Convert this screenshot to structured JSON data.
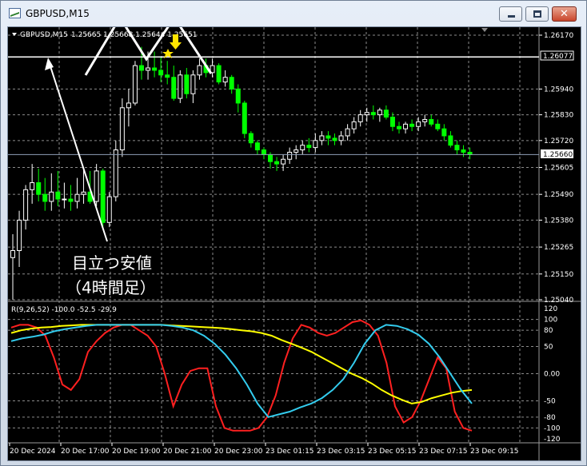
{
  "window": {
    "title": "GBPUSD,M15",
    "buttons": {
      "minimize": "minimize-icon",
      "maximize": "maximize-icon",
      "close": "close-icon"
    }
  },
  "colors": {
    "background": "#000000",
    "grid": "#8c8c8c",
    "bull_candle": "#ffffff",
    "bear_candle": "#00ff00",
    "text": "#ffffff",
    "stochastic_main": "#ff2020",
    "stochastic_slow": "#ffff00",
    "stochastic_third": "#33ccee",
    "annotation": "#ffffff",
    "arrow_marker": "#ffe400"
  },
  "price_header": {
    "symbol": "GBPUSD,M15",
    "values": "1.25665 1.25668 1.25644 1.25651"
  },
  "price_tags": {
    "high_line": "1.26077",
    "current": "1.25660"
  },
  "annotation": {
    "line1": "目立つ安値",
    "line2": "（4時間足）"
  },
  "indicator_header": "R(9,26,52) -100.0 -52.5 -29.9",
  "chart_data": [
    {
      "type": "candlestick",
      "title": "GBPUSD,M15",
      "y_ticks": [
        "1.26170",
        "1.25940",
        "1.25830",
        "1.25720",
        "1.25605",
        "1.25490",
        "1.25380",
        "1.25265",
        "1.25150",
        "1.25040"
      ],
      "ylim": [
        1.2504,
        1.2617
      ],
      "x_ticks": [
        "20 Dec 2024",
        "20 Dec 17:00",
        "20 Dec 19:00",
        "20 Dec 21:00",
        "20 Dec 23:00",
        "23 Dec 01:15",
        "23 Dec 03:15",
        "23 Dec 05:15",
        "23 Dec 07:15",
        "23 Dec 09:15"
      ],
      "horizontal_lines": [
        1.26077,
        1.2566
      ],
      "candles": [
        [
          1.2522,
          1.2532,
          1.2504,
          1.2525
        ],
        [
          1.2525,
          1.2542,
          1.2518,
          1.2538
        ],
        [
          1.2538,
          1.2553,
          1.2534,
          1.2551
        ],
        [
          1.2551,
          1.2562,
          1.2545,
          1.2554
        ],
        [
          1.2554,
          1.256,
          1.2546,
          1.2549
        ],
        [
          1.2549,
          1.2556,
          1.2542,
          1.2546
        ],
        [
          1.2546,
          1.2558,
          1.2542,
          1.255
        ],
        [
          1.255,
          1.2559,
          1.2544,
          1.2547
        ],
        [
          1.2547,
          1.2554,
          1.2543,
          1.2547
        ],
        [
          1.2547,
          1.2553,
          1.2542,
          1.2546
        ],
        [
          1.2546,
          1.2556,
          1.2543,
          1.2549
        ],
        [
          1.2549,
          1.256,
          1.2545,
          1.255
        ],
        [
          1.255,
          1.2559,
          1.2545,
          1.2546
        ],
        [
          1.2546,
          1.2562,
          1.2544,
          1.2559
        ],
        [
          1.2559,
          1.256,
          1.2534,
          1.2537
        ],
        [
          1.2537,
          1.255,
          1.2535,
          1.2548
        ],
        [
          1.2548,
          1.2572,
          1.2546,
          1.2568
        ],
        [
          1.2568,
          1.259,
          1.2565,
          1.2586
        ],
        [
          1.2586,
          1.2594,
          1.2578,
          1.2588
        ],
        [
          1.2588,
          1.2606,
          1.2587,
          1.2604
        ],
        [
          1.2604,
          1.2612,
          1.2598,
          1.2602
        ],
        [
          1.2602,
          1.261,
          1.2598,
          1.2603
        ],
        [
          1.2603,
          1.261,
          1.2599,
          1.2602
        ],
        [
          1.2602,
          1.2608,
          1.2597,
          1.26
        ],
        [
          1.26,
          1.2606,
          1.2596,
          1.2599
        ],
        [
          1.2599,
          1.2604,
          1.2589,
          1.259
        ],
        [
          1.259,
          1.2602,
          1.2588,
          1.26
        ],
        [
          1.26,
          1.2603,
          1.259,
          1.2592
        ],
        [
          1.2592,
          1.2602,
          1.2588,
          1.26
        ],
        [
          1.26,
          1.2607,
          1.2598,
          1.2604
        ],
        [
          1.2604,
          1.2607,
          1.2599,
          1.2601
        ],
        [
          1.2601,
          1.2607,
          1.2599,
          1.2604
        ],
        [
          1.2604,
          1.2605,
          1.2596,
          1.2597
        ],
        [
          1.2597,
          1.2602,
          1.2595,
          1.2599
        ],
        [
          1.2599,
          1.26,
          1.2592,
          1.2594
        ],
        [
          1.2594,
          1.2596,
          1.2584,
          1.2588
        ],
        [
          1.2588,
          1.2589,
          1.2573,
          1.2575
        ],
        [
          1.2575,
          1.2576,
          1.2569,
          1.2571
        ],
        [
          1.2571,
          1.2572,
          1.2566,
          1.2568
        ],
        [
          1.2568,
          1.2569,
          1.2564,
          1.2566
        ],
        [
          1.2566,
          1.2567,
          1.256,
          1.2563
        ],
        [
          1.2563,
          1.2565,
          1.2559,
          1.2562
        ],
        [
          1.2562,
          1.2566,
          1.2559,
          1.2564
        ],
        [
          1.2564,
          1.2569,
          1.2562,
          1.2567
        ],
        [
          1.2567,
          1.257,
          1.2564,
          1.2568
        ],
        [
          1.2568,
          1.2572,
          1.2566,
          1.257
        ],
        [
          1.257,
          1.2573,
          1.2567,
          1.2569
        ],
        [
          1.2569,
          1.2575,
          1.2567,
          1.2572
        ],
        [
          1.2572,
          1.2576,
          1.257,
          1.2574
        ],
        [
          1.2574,
          1.2576,
          1.257,
          1.2573
        ],
        [
          1.2573,
          1.2575,
          1.257,
          1.2572
        ],
        [
          1.2572,
          1.2576,
          1.257,
          1.2574
        ],
        [
          1.2574,
          1.2579,
          1.2572,
          1.2577
        ],
        [
          1.2577,
          1.2582,
          1.2575,
          1.258
        ],
        [
          1.258,
          1.2585,
          1.2578,
          1.2583
        ],
        [
          1.2583,
          1.2586,
          1.258,
          1.2584
        ],
        [
          1.2584,
          1.2587,
          1.2581,
          1.2583
        ],
        [
          1.2583,
          1.2586,
          1.258,
          1.2585
        ],
        [
          1.2585,
          1.2587,
          1.2581,
          1.2582
        ],
        [
          1.2582,
          1.2584,
          1.2576,
          1.2578
        ],
        [
          1.2578,
          1.258,
          1.2575,
          1.2577
        ],
        [
          1.2577,
          1.258,
          1.2575,
          1.2579
        ],
        [
          1.2579,
          1.2581,
          1.2576,
          1.2578
        ],
        [
          1.2578,
          1.2582,
          1.2576,
          1.258
        ],
        [
          1.258,
          1.2583,
          1.2578,
          1.2581
        ],
        [
          1.2581,
          1.2583,
          1.2578,
          1.2579
        ],
        [
          1.2579,
          1.2581,
          1.2576,
          1.2577
        ],
        [
          1.2577,
          1.2579,
          1.2572,
          1.2574
        ],
        [
          1.2574,
          1.2576,
          1.2569,
          1.257
        ],
        [
          1.257,
          1.2572,
          1.2566,
          1.2568
        ],
        [
          1.2568,
          1.257,
          1.2565,
          1.2567
        ],
        [
          1.2567,
          1.2569,
          1.2564,
          1.2566
        ]
      ]
    },
    {
      "type": "line",
      "title": "R(9,26,52) -100.0 -52.5 -29.9",
      "y_ticks": [
        "120",
        "100",
        "80",
        "50",
        "0.00",
        "-50",
        "-80",
        "-100",
        "-120"
      ],
      "ylim": [
        -120,
        120
      ],
      "series": [
        {
          "color": "#ff2020",
          "values": [
            85,
            90,
            90,
            85,
            70,
            30,
            -20,
            -30,
            -10,
            40,
            60,
            75,
            85,
            90,
            90,
            80,
            70,
            50,
            0,
            -60,
            -20,
            5,
            10,
            10,
            -60,
            -100,
            -105,
            -105,
            -105,
            -100,
            -80,
            -40,
            20,
            65,
            90,
            85,
            75,
            70,
            75,
            85,
            95,
            98,
            90,
            70,
            20,
            -60,
            -90,
            -80,
            -50,
            -10,
            30,
            10,
            -70,
            -100,
            -105
          ]
        },
        {
          "color": "#ffff00",
          "values": [
            75,
            80,
            83,
            85,
            86,
            88,
            89,
            90,
            90,
            90,
            90,
            90,
            90,
            90,
            90,
            90,
            89,
            88,
            87,
            86,
            85,
            84,
            82,
            80,
            78,
            75,
            70,
            62,
            55,
            48,
            40,
            30,
            20,
            10,
            0,
            -8,
            -18,
            -30,
            -40,
            -48,
            -55,
            -52,
            -45,
            -40,
            -35,
            -32,
            -30
          ]
        },
        {
          "color": "#33ccee",
          "values": [
            60,
            65,
            68,
            72,
            78,
            82,
            85,
            88,
            90,
            90,
            90,
            90,
            90,
            90,
            90,
            88,
            85,
            80,
            70,
            55,
            35,
            10,
            -20,
            -55,
            -80,
            -75,
            -70,
            -62,
            -55,
            -45,
            -30,
            -10,
            20,
            55,
            80,
            90,
            88,
            82,
            72,
            55,
            30,
            0,
            -30,
            -55
          ]
        }
      ]
    }
  ]
}
